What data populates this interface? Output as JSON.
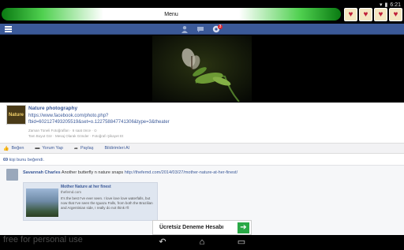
{
  "statusbar": {
    "menu_label": "Menu",
    "time": "6:21",
    "app_icons": [
      "heart-app-icon",
      "heart-app-icon",
      "heart-app-icon",
      "heart-app-icon"
    ]
  },
  "fbbar": {
    "color": "#3b5998",
    "notification_count": "3"
  },
  "post": {
    "page_name": "Nature photography",
    "url": "https://www.facebook.com/photo.php?fbid=602127493205519&set=o.122758847741306&type=3&theater",
    "meta_line1": "Zaman Tüneli Fotoğrafları · 6 saat önce · ⊙",
    "meta_line2": "Tam Boyut Gör · Mesaj Olarak Gönder · Fotoğrafı Şikayet Et",
    "avatar_text": "Nature"
  },
  "actions": {
    "like": "Beğen",
    "comment": "Yorum Yap",
    "share": "Paylaş",
    "notify": "Bildirimleri Al"
  },
  "likes": {
    "count": "69",
    "text": " kişi bunu beğendi."
  },
  "comment": {
    "author": "Savannah Charles",
    "text": " Another butterfly n nature snaps ",
    "link": "http://thefemd.com/2014/03/27/mother-nature-at-her-finest/",
    "attachment": {
      "title": "Mother Nature at her finest",
      "domain": "thefemd.com",
      "description": "It's the best I've ever seen. I love love love waterfalls, but now that I've seen the Iguazu Falls, from both the Brazilian and Argentinian side, I really do not think I'll"
    }
  },
  "ad": {
    "text": "Ücretsiz Deneme Hesabı",
    "button_icon": "arrow-right-icon"
  },
  "watermark": "free for personal use",
  "navbar": {
    "back": "back-icon",
    "home": "home-icon",
    "recents": "recents-icon"
  }
}
